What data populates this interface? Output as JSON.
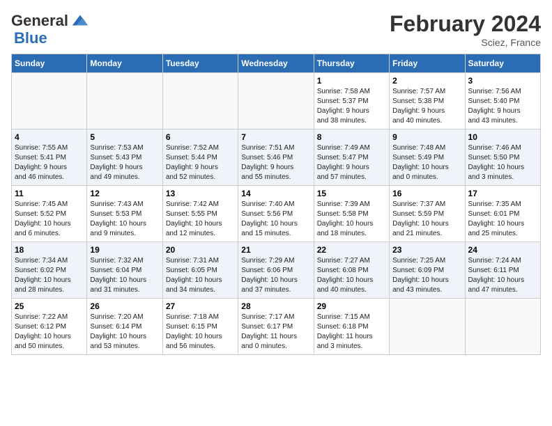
{
  "header": {
    "logo_general": "General",
    "logo_blue": "Blue",
    "month_title": "February 2024",
    "location": "Sciez, France"
  },
  "weekdays": [
    "Sunday",
    "Monday",
    "Tuesday",
    "Wednesday",
    "Thursday",
    "Friday",
    "Saturday"
  ],
  "weeks": [
    [
      {
        "day": "",
        "info": ""
      },
      {
        "day": "",
        "info": ""
      },
      {
        "day": "",
        "info": ""
      },
      {
        "day": "",
        "info": ""
      },
      {
        "day": "1",
        "info": "Sunrise: 7:58 AM\nSunset: 5:37 PM\nDaylight: 9 hours\nand 38 minutes."
      },
      {
        "day": "2",
        "info": "Sunrise: 7:57 AM\nSunset: 5:38 PM\nDaylight: 9 hours\nand 40 minutes."
      },
      {
        "day": "3",
        "info": "Sunrise: 7:56 AM\nSunset: 5:40 PM\nDaylight: 9 hours\nand 43 minutes."
      }
    ],
    [
      {
        "day": "4",
        "info": "Sunrise: 7:55 AM\nSunset: 5:41 PM\nDaylight: 9 hours\nand 46 minutes."
      },
      {
        "day": "5",
        "info": "Sunrise: 7:53 AM\nSunset: 5:43 PM\nDaylight: 9 hours\nand 49 minutes."
      },
      {
        "day": "6",
        "info": "Sunrise: 7:52 AM\nSunset: 5:44 PM\nDaylight: 9 hours\nand 52 minutes."
      },
      {
        "day": "7",
        "info": "Sunrise: 7:51 AM\nSunset: 5:46 PM\nDaylight: 9 hours\nand 55 minutes."
      },
      {
        "day": "8",
        "info": "Sunrise: 7:49 AM\nSunset: 5:47 PM\nDaylight: 9 hours\nand 57 minutes."
      },
      {
        "day": "9",
        "info": "Sunrise: 7:48 AM\nSunset: 5:49 PM\nDaylight: 10 hours\nand 0 minutes."
      },
      {
        "day": "10",
        "info": "Sunrise: 7:46 AM\nSunset: 5:50 PM\nDaylight: 10 hours\nand 3 minutes."
      }
    ],
    [
      {
        "day": "11",
        "info": "Sunrise: 7:45 AM\nSunset: 5:52 PM\nDaylight: 10 hours\nand 6 minutes."
      },
      {
        "day": "12",
        "info": "Sunrise: 7:43 AM\nSunset: 5:53 PM\nDaylight: 10 hours\nand 9 minutes."
      },
      {
        "day": "13",
        "info": "Sunrise: 7:42 AM\nSunset: 5:55 PM\nDaylight: 10 hours\nand 12 minutes."
      },
      {
        "day": "14",
        "info": "Sunrise: 7:40 AM\nSunset: 5:56 PM\nDaylight: 10 hours\nand 15 minutes."
      },
      {
        "day": "15",
        "info": "Sunrise: 7:39 AM\nSunset: 5:58 PM\nDaylight: 10 hours\nand 18 minutes."
      },
      {
        "day": "16",
        "info": "Sunrise: 7:37 AM\nSunset: 5:59 PM\nDaylight: 10 hours\nand 21 minutes."
      },
      {
        "day": "17",
        "info": "Sunrise: 7:35 AM\nSunset: 6:01 PM\nDaylight: 10 hours\nand 25 minutes."
      }
    ],
    [
      {
        "day": "18",
        "info": "Sunrise: 7:34 AM\nSunset: 6:02 PM\nDaylight: 10 hours\nand 28 minutes."
      },
      {
        "day": "19",
        "info": "Sunrise: 7:32 AM\nSunset: 6:04 PM\nDaylight: 10 hours\nand 31 minutes."
      },
      {
        "day": "20",
        "info": "Sunrise: 7:31 AM\nSunset: 6:05 PM\nDaylight: 10 hours\nand 34 minutes."
      },
      {
        "day": "21",
        "info": "Sunrise: 7:29 AM\nSunset: 6:06 PM\nDaylight: 10 hours\nand 37 minutes."
      },
      {
        "day": "22",
        "info": "Sunrise: 7:27 AM\nSunset: 6:08 PM\nDaylight: 10 hours\nand 40 minutes."
      },
      {
        "day": "23",
        "info": "Sunrise: 7:25 AM\nSunset: 6:09 PM\nDaylight: 10 hours\nand 43 minutes."
      },
      {
        "day": "24",
        "info": "Sunrise: 7:24 AM\nSunset: 6:11 PM\nDaylight: 10 hours\nand 47 minutes."
      }
    ],
    [
      {
        "day": "25",
        "info": "Sunrise: 7:22 AM\nSunset: 6:12 PM\nDaylight: 10 hours\nand 50 minutes."
      },
      {
        "day": "26",
        "info": "Sunrise: 7:20 AM\nSunset: 6:14 PM\nDaylight: 10 hours\nand 53 minutes."
      },
      {
        "day": "27",
        "info": "Sunrise: 7:18 AM\nSunset: 6:15 PM\nDaylight: 10 hours\nand 56 minutes."
      },
      {
        "day": "28",
        "info": "Sunrise: 7:17 AM\nSunset: 6:17 PM\nDaylight: 11 hours\nand 0 minutes."
      },
      {
        "day": "29",
        "info": "Sunrise: 7:15 AM\nSunset: 6:18 PM\nDaylight: 11 hours\nand 3 minutes."
      },
      {
        "day": "",
        "info": ""
      },
      {
        "day": "",
        "info": ""
      }
    ]
  ]
}
